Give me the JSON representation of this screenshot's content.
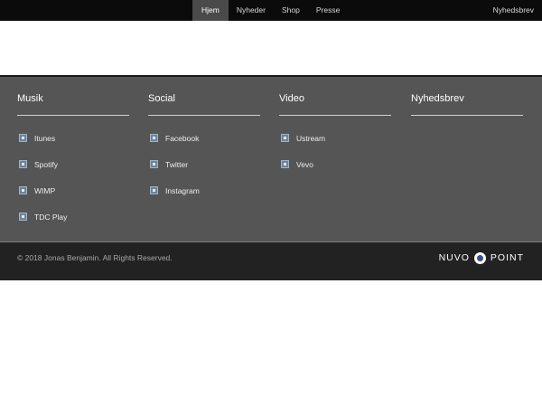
{
  "nav": {
    "items": [
      {
        "label": "Hjem",
        "active": true
      },
      {
        "label": "Nyheder",
        "active": false
      },
      {
        "label": "Shop",
        "active": false
      },
      {
        "label": "Presse",
        "active": false
      }
    ],
    "right_label": "Nyhedsbrev"
  },
  "footer": {
    "columns": [
      {
        "title": "Musik",
        "links": [
          "Itunes",
          "Spotify",
          "WIMP",
          "TDC Play"
        ]
      },
      {
        "title": "Social",
        "links": [
          "Facebook",
          "Twitter",
          "Instagram"
        ]
      },
      {
        "title": "Video",
        "links": [
          "Ustream",
          "Vevo"
        ]
      },
      {
        "title": "Nyhedsbrev",
        "links": []
      }
    ],
    "copyright": "© 2018 Jonas Benjamin. All Rights Reserved.",
    "brand": {
      "left": "NUVO",
      "right": "POINT"
    }
  },
  "colors": {
    "topbar": "#0b0b0b",
    "footer_main": "#555555",
    "footer_bottom": "#222222"
  }
}
